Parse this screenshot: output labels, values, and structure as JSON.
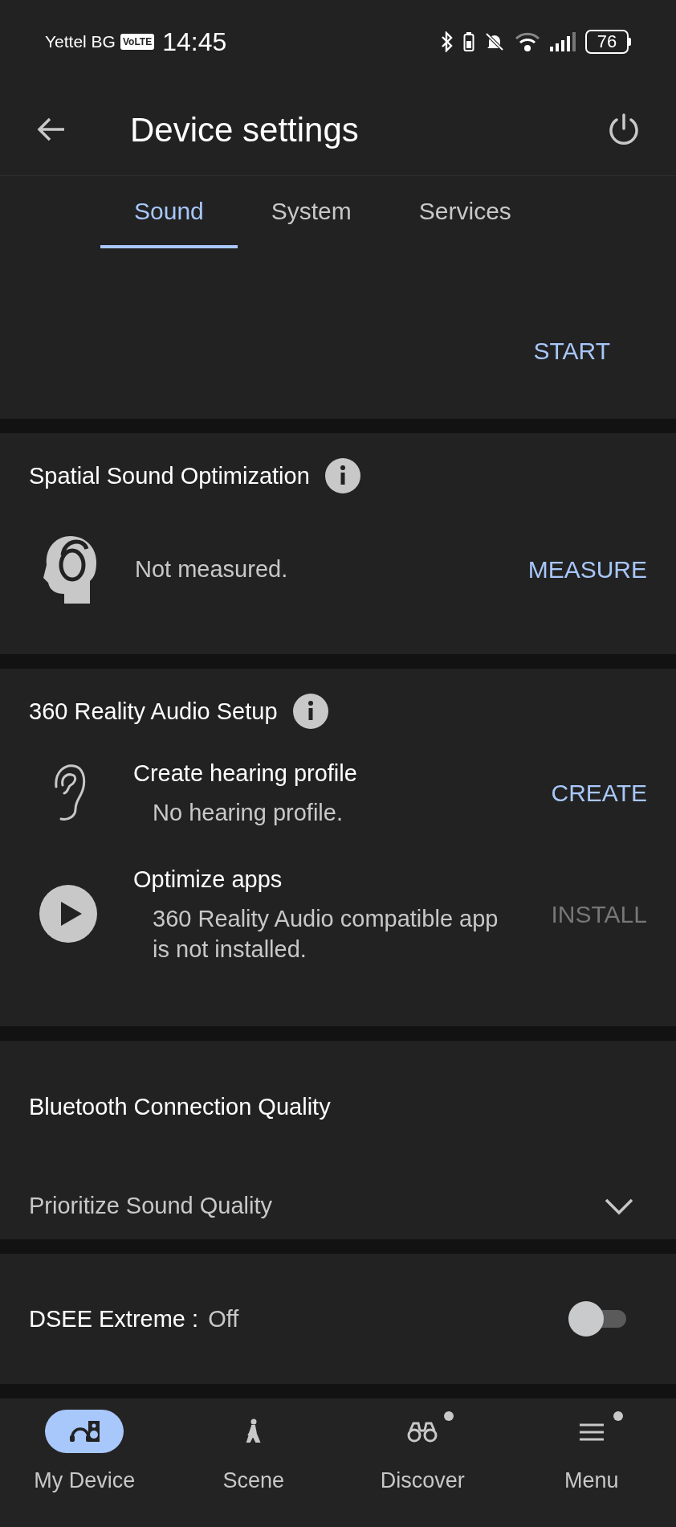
{
  "status_bar": {
    "carrier": "Yettel BG",
    "network_badge": "VoLTE",
    "time": "14:45",
    "battery": "76"
  },
  "app_bar": {
    "title": "Device settings"
  },
  "tabs": [
    {
      "label": "Sound",
      "selected": true
    },
    {
      "label": "System",
      "selected": false
    },
    {
      "label": "Services",
      "selected": false
    }
  ],
  "sections": [
    {
      "kind": "action",
      "button": "START"
    },
    {
      "kind": "measure",
      "title": "Spatial Sound Optimization",
      "status": "Not measured.",
      "button": "MEASURE"
    },
    {
      "kind": "list",
      "title": "360 Reality Audio Setup",
      "items": [
        {
          "title": "Create hearing profile",
          "subtitle": "No hearing profile.",
          "button": "CREATE",
          "disabled": false
        },
        {
          "title": "Optimize apps",
          "subtitle": "360 Reality Audio compatible app is not installed.",
          "button": "INSTALL",
          "disabled": true
        }
      ]
    },
    {
      "kind": "dropdown",
      "title": "Bluetooth Connection Quality",
      "value": "Prioritize Sound Quality"
    },
    {
      "kind": "toggle",
      "label": "DSEE Extreme :",
      "value": "Off",
      "on": false
    }
  ],
  "bottom_nav": [
    {
      "label": "My Device",
      "selected": true,
      "badge": false
    },
    {
      "label": "Scene",
      "selected": false,
      "badge": false
    },
    {
      "label": "Discover",
      "selected": false,
      "badge": true
    },
    {
      "label": "Menu",
      "selected": false,
      "badge": true
    }
  ]
}
